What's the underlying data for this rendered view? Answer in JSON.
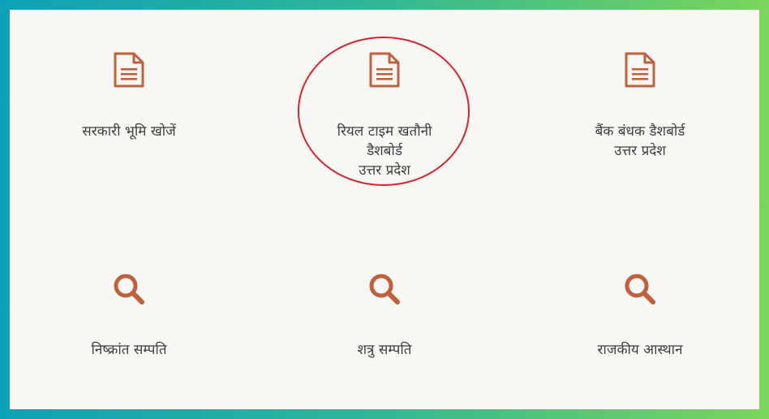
{
  "tiles": [
    {
      "label": "सरकारी भूमि खोजें",
      "icon": "document-icon"
    },
    {
      "label": "रियल टाइम खतौनी\nडैशबोर्ड\nउत्तर प्रदेश",
      "icon": "document-icon"
    },
    {
      "label": "बैंक बंधक डैशबोर्ड\nउत्तर प्रदेश",
      "icon": "document-icon"
    },
    {
      "label": "निष्क्रांत सम्पति",
      "icon": "search-icon"
    },
    {
      "label": "शत्रु सम्पति",
      "icon": "search-icon"
    },
    {
      "label": "राजकीय आस्थान",
      "icon": "search-icon"
    }
  ],
  "colors": {
    "icon": "#c0603d",
    "text": "#3f3f3f",
    "panel": "#f9f7f4",
    "highlight": "#d7242e"
  }
}
